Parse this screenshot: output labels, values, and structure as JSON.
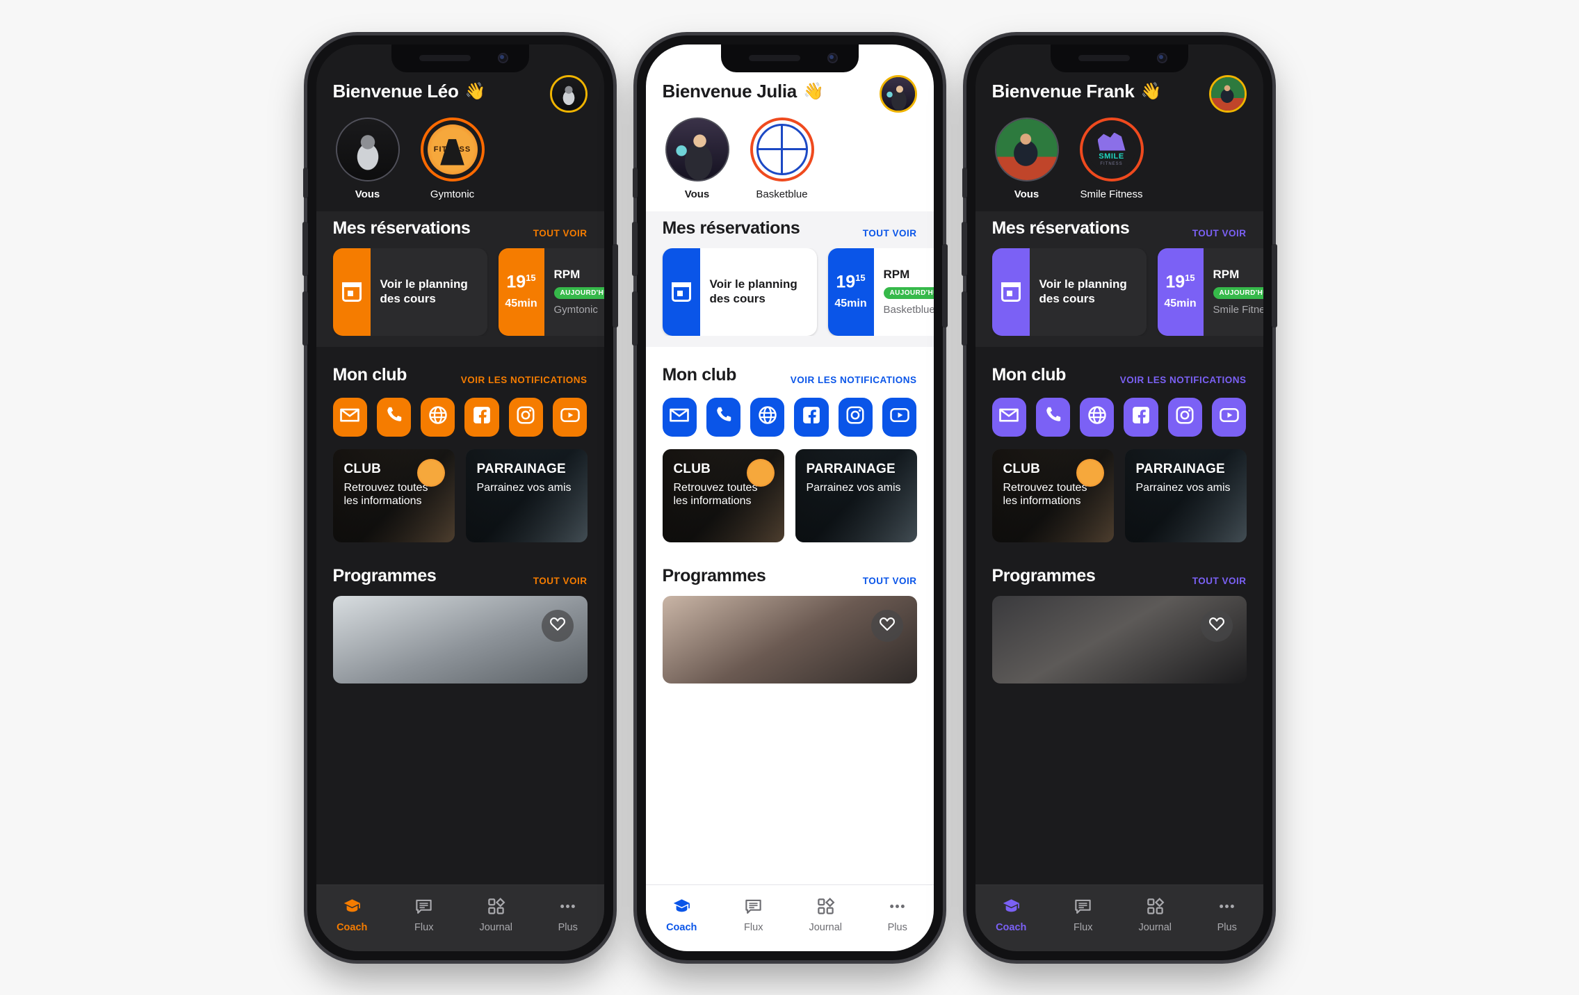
{
  "phones": [
    {
      "id": "leo",
      "theme": "theme-dark",
      "accent": "#f57c00",
      "ring": "#ff6a00",
      "greeting": "Bienvenue Léo",
      "wave": "👋",
      "avatar_class": "ph-leo",
      "logo_kind": "gym",
      "clubs": [
        {
          "label": "Vous"
        },
        {
          "label": "Gymtonic"
        }
      ],
      "reservations": {
        "title": "Mes réservations",
        "link": "TOUT VOIR",
        "planning_card": {
          "title": "Voir le planning des cours",
          "icon": "calendar-icon"
        },
        "class_card": {
          "hour": "19",
          "minutes": "15",
          "duration": "45min",
          "name": "RPM",
          "badge": "AUJOURD'HUI",
          "club": "Gymtonic"
        }
      },
      "club_section": {
        "title": "Mon club",
        "link": "VOIR LES NOTIFICATIONS",
        "socials": [
          "mail-icon",
          "phone-icon",
          "globe-icon",
          "facebook-icon",
          "instagram-icon",
          "youtube-icon"
        ],
        "promos": [
          {
            "heading": "CLUB",
            "sub": "Retrouvez toutes les informations",
            "has_badge": true
          },
          {
            "heading": "PARRAINAGE",
            "sub": "Parrainez vos amis",
            "has_badge": false
          }
        ]
      },
      "programmes": {
        "title": "Programmes",
        "link": "TOUT VOIR",
        "image_class": ""
      },
      "tabs": [
        {
          "label": "Coach",
          "icon": "graduation-cap-icon",
          "active": true
        },
        {
          "label": "Flux",
          "icon": "chat-bubble-icon",
          "active": false
        },
        {
          "label": "Journal",
          "icon": "grid-icon",
          "active": false
        },
        {
          "label": "Plus",
          "icon": "ellipsis-icon",
          "active": false
        }
      ]
    },
    {
      "id": "julia",
      "theme": "theme-light",
      "accent": "#0a55e8",
      "ring": "#ef4a1e",
      "greeting": "Bienvenue Julia",
      "wave": "👋",
      "avatar_class": "ph-julia",
      "logo_kind": "basket",
      "clubs": [
        {
          "label": "Vous"
        },
        {
          "label": "Basketblue"
        }
      ],
      "reservations": {
        "title": "Mes réservations",
        "link": "TOUT VOIR",
        "planning_card": {
          "title": "Voir le planning des cours",
          "icon": "calendar-icon"
        },
        "class_card": {
          "hour": "19",
          "minutes": "15",
          "duration": "45min",
          "name": "RPM",
          "badge": "AUJOURD'HUI",
          "club": "Basketblue"
        }
      },
      "club_section": {
        "title": "Mon club",
        "link": "VOIR LES NOTIFICATIONS",
        "socials": [
          "mail-icon",
          "phone-icon",
          "globe-icon",
          "facebook-icon",
          "instagram-icon",
          "youtube-icon"
        ],
        "promos": [
          {
            "heading": "CLUB",
            "sub": "Retrouvez toutes les informations",
            "has_badge": true
          },
          {
            "heading": "PARRAINAGE",
            "sub": "Parrainez vos amis",
            "has_badge": false
          }
        ]
      },
      "programmes": {
        "title": "Programmes",
        "link": "TOUT VOIR",
        "image_class": "alt"
      },
      "tabs": [
        {
          "label": "Coach",
          "icon": "graduation-cap-icon",
          "active": true
        },
        {
          "label": "Flux",
          "icon": "chat-bubble-icon",
          "active": false
        },
        {
          "label": "Journal",
          "icon": "grid-icon",
          "active": false
        },
        {
          "label": "Plus",
          "icon": "ellipsis-icon",
          "active": false
        }
      ]
    },
    {
      "id": "frank",
      "theme": "theme-dark",
      "accent": "#7b61f5",
      "ring": "#ef4a1e",
      "greeting": "Bienvenue Frank",
      "wave": "👋",
      "avatar_class": "ph-frank",
      "logo_kind": "smile",
      "clubs": [
        {
          "label": "Vous"
        },
        {
          "label": "Smile Fitness"
        }
      ],
      "reservations": {
        "title": "Mes réservations",
        "link": "TOUT VOIR",
        "planning_card": {
          "title": "Voir le planning des cours",
          "icon": "calendar-icon"
        },
        "class_card": {
          "hour": "19",
          "minutes": "15",
          "duration": "45min",
          "name": "RPM",
          "badge": "AUJOURD'HUI",
          "club": "Smile Fitness"
        }
      },
      "club_section": {
        "title": "Mon club",
        "link": "VOIR LES NOTIFICATIONS",
        "socials": [
          "mail-icon",
          "phone-icon",
          "globe-icon",
          "facebook-icon",
          "instagram-icon",
          "youtube-icon"
        ],
        "promos": [
          {
            "heading": "CLUB",
            "sub": "Retrouvez toutes les informations",
            "has_badge": true
          },
          {
            "heading": "PARRAINAGE",
            "sub": "Parrainez vos amis",
            "has_badge": false
          }
        ]
      },
      "programmes": {
        "title": "Programmes",
        "link": "TOUT VOIR",
        "image_class": "alt2"
      },
      "tabs": [
        {
          "label": "Coach",
          "icon": "graduation-cap-icon",
          "active": true
        },
        {
          "label": "Flux",
          "icon": "chat-bubble-icon",
          "active": false
        },
        {
          "label": "Journal",
          "icon": "grid-icon",
          "active": false
        },
        {
          "label": "Plus",
          "icon": "ellipsis-icon",
          "active": false
        }
      ]
    }
  ],
  "smile_logo": {
    "name": "SMILE",
    "sub": "FITNESS"
  },
  "gym_logo": {
    "name": "FITNESS"
  }
}
